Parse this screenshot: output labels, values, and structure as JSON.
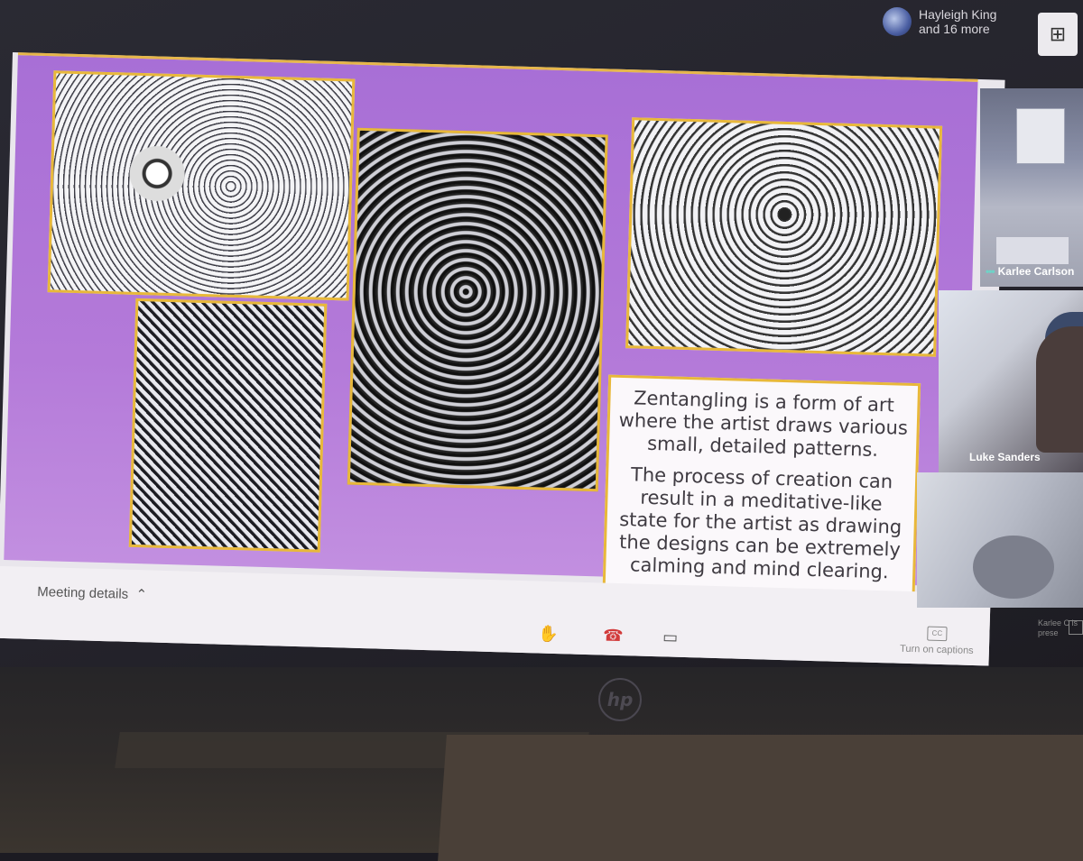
{
  "header": {
    "participant_name": "Hayleigh King",
    "participant_more": "and 16 more",
    "layout_icon": "grid-icon"
  },
  "slide": {
    "caption_p1": "Zentangling is a form of art where the artist draws various small, detailed patterns.",
    "caption_p2": "The process of creation can result in a meditative-like state for the artist as drawing the designs can be extremely calming and mind clearing.",
    "accent_color": "#e8b83a",
    "background_color": "#b47ad9"
  },
  "participants": [
    {
      "name": "Karlee Carlson"
    },
    {
      "name": "Luke Sanders"
    }
  ],
  "toolbar": {
    "meeting_details": "Meeting details",
    "raise_hand_icon": "hand-icon",
    "hangup_icon": "phone-hangup-icon",
    "camera_icon": "camera-icon",
    "captions_label": "Turn on captions",
    "presenting_label": "Karlee C is prese"
  },
  "device": {
    "brand": "hp"
  }
}
